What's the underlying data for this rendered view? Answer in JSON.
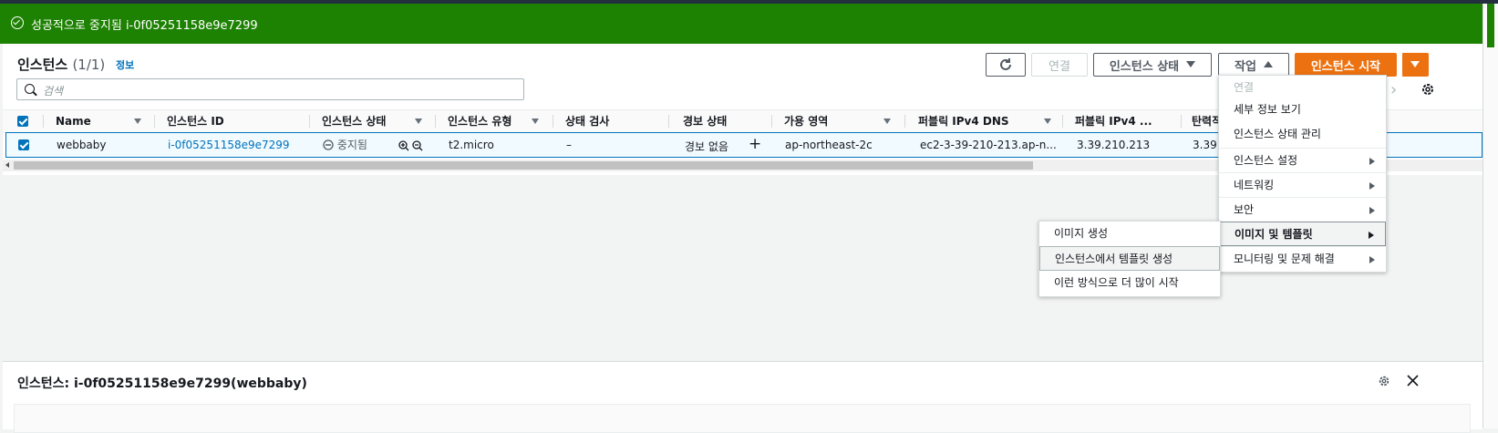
{
  "flash": {
    "message": "성공적으로 중지됨 i-0f05251158e9e7299"
  },
  "header": {
    "title": "인스턴스",
    "count": "(1/1)",
    "info": "정보"
  },
  "toolbar": {
    "connect": "연결",
    "instance_state": "인스턴스 상태",
    "actions": "작업",
    "launch": "인스턴스 시작"
  },
  "search": {
    "placeholder": "검색"
  },
  "columns": [
    "Name",
    "인스턴스 ID",
    "인스턴스 상태",
    "인스턴스 유형",
    "상태 검사",
    "경보 상태",
    "가용 영역",
    "퍼블릭 IPv4 DNS",
    "퍼블릭 IPv4 ...",
    "탄력적"
  ],
  "row": {
    "name": "webbaby",
    "instance_id": "i-0f05251158e9e7299",
    "state": "중지됨",
    "type": "t2.micro",
    "status_check": "–",
    "alarm": "경보 없음",
    "az": "ap-northeast-2c",
    "dns": "ec2-3-39-210-213.ap-n...",
    "ipv4": "3.39.210.213",
    "eip": "3.39."
  },
  "actions_menu": {
    "items": [
      "연결",
      "세부 정보 보기",
      "인스턴스 상태 관리",
      "인스턴스 설정",
      "네트워킹",
      "보안",
      "이미지 및 템플릿",
      "모니터링 및 문제 해결"
    ]
  },
  "image_submenu": {
    "items": [
      "이미지 생성",
      "인스턴스에서 템플릿 생성",
      "이런 방식으로 더 많이 시작"
    ]
  },
  "details": {
    "title": "인스턴스: i-0f05251158e9e7299(webbaby)"
  },
  "colors": {
    "success": "#1d8102",
    "primary": "#ec7211",
    "link": "#0073bb"
  }
}
